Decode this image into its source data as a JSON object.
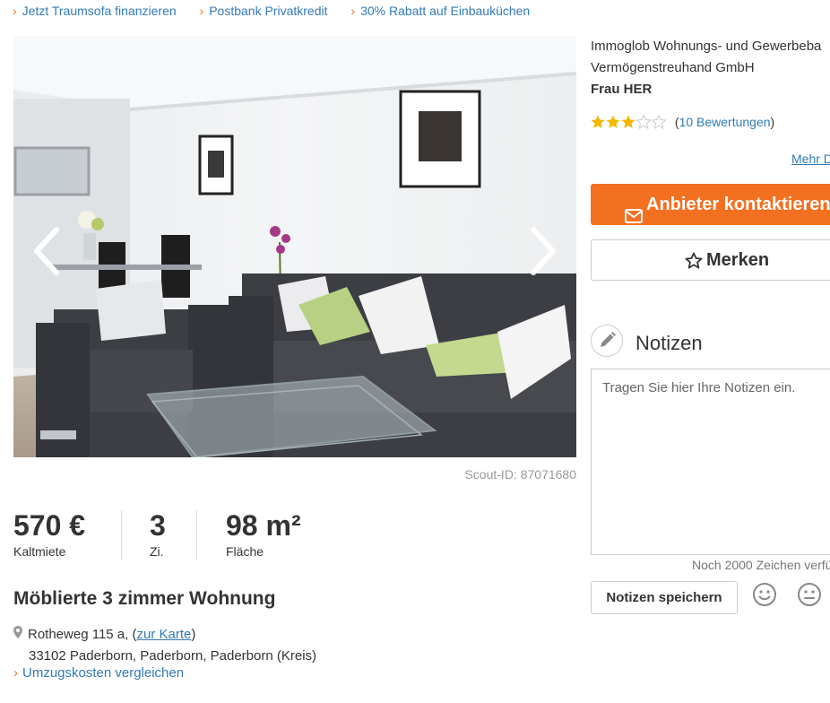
{
  "top_links": [
    {
      "label": "Jetzt Traumsofa finanzieren"
    },
    {
      "label": "Postbank Privatkredit"
    },
    {
      "label": "30% Rabatt auf Einbauküchen"
    }
  ],
  "gallery": {
    "image_alt": "Wohnzimmer mit grauen Sofas",
    "prev_icon": "chevron-left-icon",
    "next_icon": "chevron-right-icon"
  },
  "scout_id": "Scout-ID: 87071680",
  "facts": [
    {
      "value": "570 €",
      "label": "Kaltmiete"
    },
    {
      "value": "3",
      "label": "Zi."
    },
    {
      "value": "98 m²",
      "label": "Fläche"
    }
  ],
  "listing": {
    "title": "Möblierte 3 zimmer Wohnung",
    "street_prefix": "Rotheweg 115 a, (",
    "map_link": "zur Karte",
    "street_suffix": ")",
    "city_line": "33102 Paderborn, Paderborn, Paderborn (Kreis)",
    "moving_cost_link": "Umzugskosten vergleichen"
  },
  "provider": {
    "company_line1": "Immoglob Wohnungs- und Gewerbeba",
    "company_line2": "Vermögenstreuhand GmbH",
    "contact_name": "Frau HER",
    "rating_stars": 3,
    "rating_max": 5,
    "reviews_open": "(",
    "reviews_link": "10 Bewertungen",
    "reviews_close": ")",
    "more_link": "Mehr D",
    "star_color": "#f5b800"
  },
  "actions": {
    "contact_label": "Anbieter kontaktieren",
    "save_label": "Merken",
    "accent": "#f37021"
  },
  "notes": {
    "title": "Notizen",
    "placeholder": "Tragen Sie hier Ihre Notizen ein.",
    "remaining": "Noch 2000 Zeichen verfü",
    "save_button": "Notizen speichern"
  }
}
